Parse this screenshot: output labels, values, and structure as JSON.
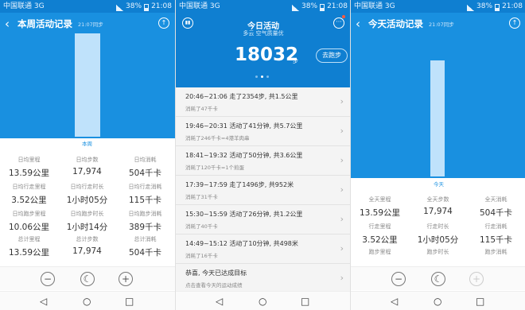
{
  "status_bar": {
    "carrier": "中国联通 3G",
    "battery": "38%",
    "time": "21:08"
  },
  "screen1": {
    "title": "本周活动记录",
    "sync": "21:07同步",
    "bar_label": "本周",
    "stats": [
      {
        "label": "日均里程",
        "value": "13.59公里"
      },
      {
        "label": "日均步数",
        "value": "17,974"
      },
      {
        "label": "日均消耗",
        "value": "504千卡"
      },
      {
        "label": "日均行走里程",
        "value": "3.52公里"
      },
      {
        "label": "日均行走时长",
        "value": "1小时05分"
      },
      {
        "label": "日均行走消耗",
        "value": "115千卡"
      },
      {
        "label": "日均跑步里程",
        "value": "10.06公里"
      },
      {
        "label": "日均跑步时长",
        "value": "1小时14分"
      },
      {
        "label": "日均跑步消耗",
        "value": "389千卡"
      },
      {
        "label": "总计里程",
        "value": "13.59公里"
      },
      {
        "label": "总计步数",
        "value": "17,974"
      },
      {
        "label": "总计消耗",
        "value": "504千卡"
      }
    ],
    "controls": {
      "minus": "−",
      "moon": "☾",
      "plus": "+"
    }
  },
  "screen2": {
    "title": "今日活动",
    "weather": "多云 空气质量优",
    "steps": "18032",
    "steps_unit": "步",
    "run_button": "去跑步",
    "items": [
      {
        "title": "20:46~21:06 走了2354步, 共1.5公里",
        "sub": "消耗了47千卡"
      },
      {
        "title": "19:46~20:31 活动了41分钟, 共5.7公里",
        "sub": "消耗了246千卡=4港羊肉串"
      },
      {
        "title": "18:41~19:32 活动了50分钟, 共3.6公里",
        "sub": "消耗了120千卡=1个煎蛋"
      },
      {
        "title": "17:39~17:59 走了1496步, 共952米",
        "sub": "消耗了31千卡"
      },
      {
        "title": "15:30~15:59 活动了26分钟, 共1.2公里",
        "sub": "消耗了40千卡"
      },
      {
        "title": "14:49~15:12 活动了10分钟, 共498米",
        "sub": "消耗了16千卡"
      },
      {
        "title": "恭喜, 今天已达成目标",
        "sub": "点击查看今天的运动成绩"
      }
    ]
  },
  "screen3": {
    "title": "今天活动记录",
    "sync": "21:07同步",
    "bar_label": "今天",
    "stats": [
      {
        "label": "全天里程",
        "value": "13.59公里"
      },
      {
        "label": "全天步数",
        "value": "17,974"
      },
      {
        "label": "全天消耗",
        "value": "504千卡"
      },
      {
        "label": "行走里程",
        "value": "3.52公里"
      },
      {
        "label": "行走时长",
        "value": "1小时05分"
      },
      {
        "label": "行走消耗",
        "value": "115千卡"
      },
      {
        "label": "跑步里程",
        "value": ""
      },
      {
        "label": "跑步时长",
        "value": ""
      },
      {
        "label": "跑步消耗",
        "value": ""
      }
    ],
    "controls": {
      "minus": "−",
      "moon": "☾",
      "plus": "+"
    }
  },
  "sysnav": {
    "back": "◁",
    "home": "○",
    "recent": "□"
  },
  "colors": {
    "header_blue": "#1990e0",
    "status_blue": "#0f7fd1",
    "bar": "#bfe2fb"
  }
}
